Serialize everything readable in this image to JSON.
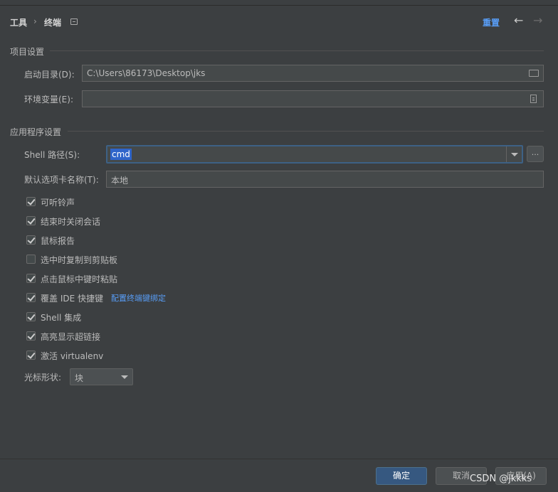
{
  "breadcrumb": {
    "item1": "工具",
    "separator": "›",
    "item2": "终端"
  },
  "header": {
    "reset_label": "重置",
    "back_arrow": "←",
    "forward_arrow": "→"
  },
  "project_section": {
    "title": "项目设置",
    "start_dir_label": "启动目录(D):",
    "start_dir_value": "C:\\Users\\86173\\Desktop\\jks",
    "env_label": "环境变量(E):",
    "env_value": ""
  },
  "app_section": {
    "title": "应用程序设置",
    "shell_path_label": "Shell 路径(S):",
    "shell_path_value": "cmd",
    "browse_label": "...",
    "tab_name_label": "默认选项卡名称(T):",
    "tab_name_value": "本地"
  },
  "checkboxes": [
    {
      "label": "可听铃声",
      "checked": true
    },
    {
      "label": "结束时关闭会话",
      "checked": true
    },
    {
      "label": "鼠标报告",
      "checked": true
    },
    {
      "label": "选中时复制到剪贴板",
      "checked": false
    },
    {
      "label": "点击鼠标中键时粘贴",
      "checked": true
    },
    {
      "label": "覆盖 IDE 快捷键",
      "checked": true
    },
    {
      "label": "Shell 集成",
      "checked": true
    },
    {
      "label": "高亮显示超链接",
      "checked": true
    },
    {
      "label": "激活 virtualenv",
      "checked": true
    }
  ],
  "keymap_link": "配置终端键绑定",
  "cursor_shape": {
    "label": "光标形状:",
    "value": "块"
  },
  "footer": {
    "ok_label": "确定",
    "cancel_label": "取消",
    "apply_label": "应用(A)"
  },
  "watermark": "CSDN @jkkks",
  "colors": {
    "accent": "#589df6",
    "primary_button": "#365880",
    "selection": "#2f65ca",
    "background": "#3c3f41"
  }
}
